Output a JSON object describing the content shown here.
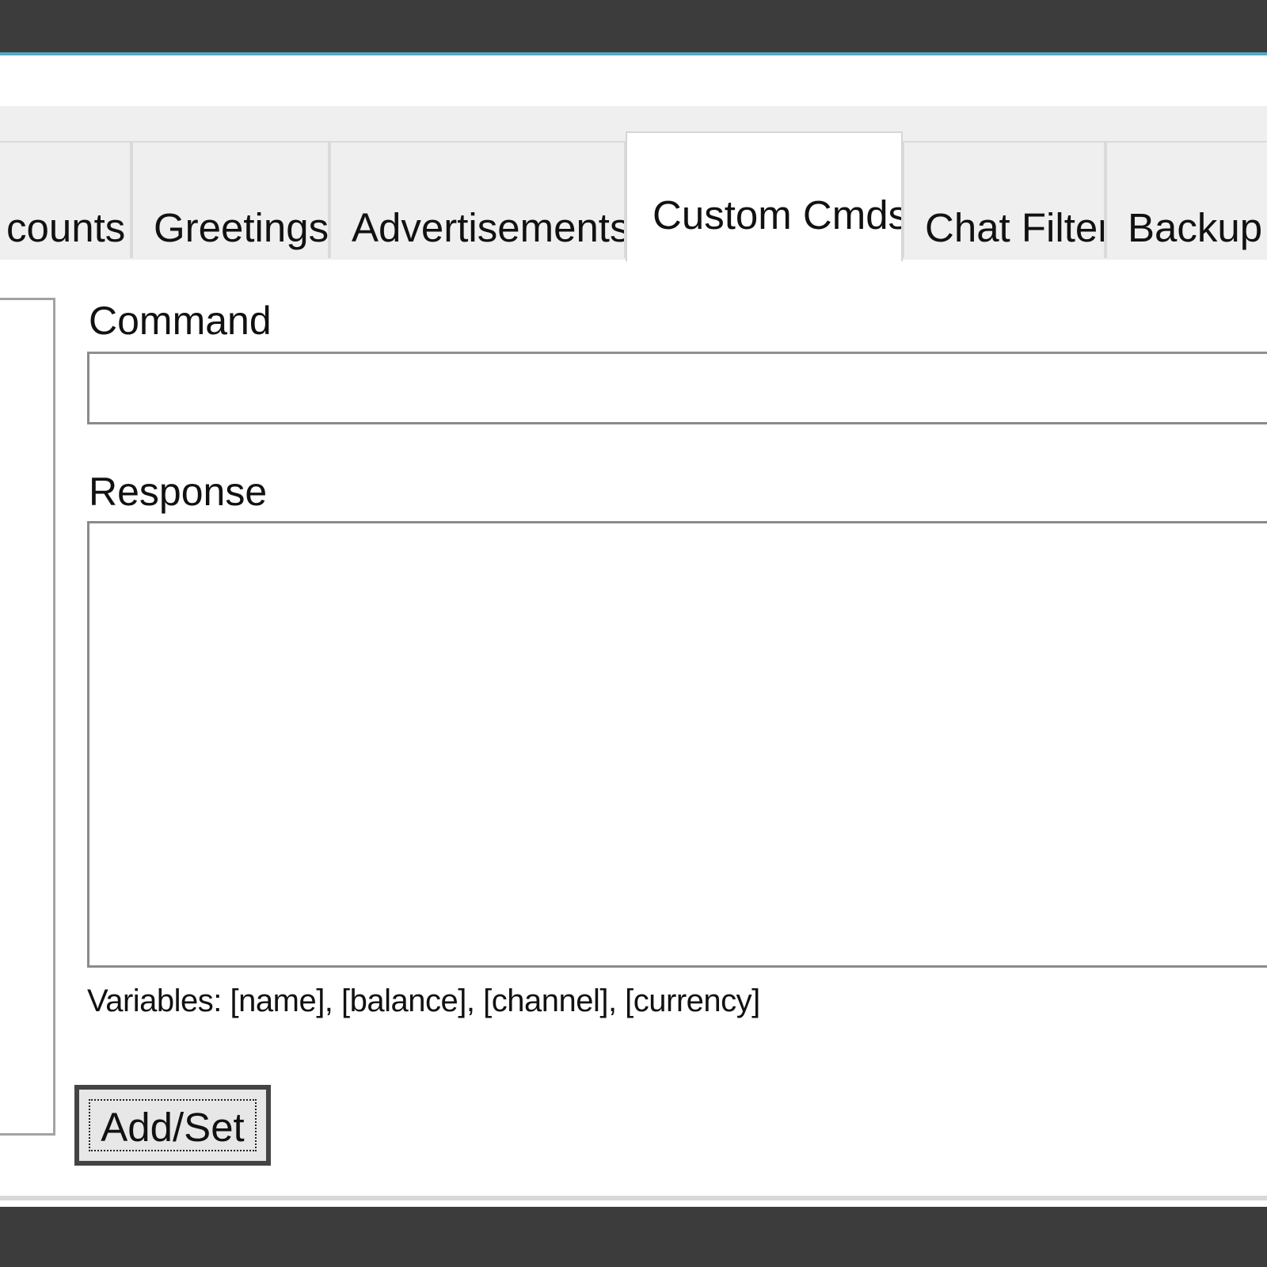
{
  "tabs": [
    {
      "label": "counts",
      "selected": false
    },
    {
      "label": "Greetings",
      "selected": false
    },
    {
      "label": "Advertisements",
      "selected": false
    },
    {
      "label": "Custom Cmds",
      "selected": true
    },
    {
      "label": "Chat Filter",
      "selected": false
    },
    {
      "label": "Backup",
      "selected": false
    }
  ],
  "form": {
    "command_label": "Command",
    "command_value": "",
    "response_label": "Response",
    "response_value": "",
    "variables_hint": "Variables: [name], [balance], [channel], [currency]",
    "add_set_label": "Add/Set"
  },
  "colors": {
    "chrome": "#3c3c3c",
    "accent": "#57a7c4",
    "tab_bg": "#efefef",
    "window_bg": "#ffffff"
  }
}
